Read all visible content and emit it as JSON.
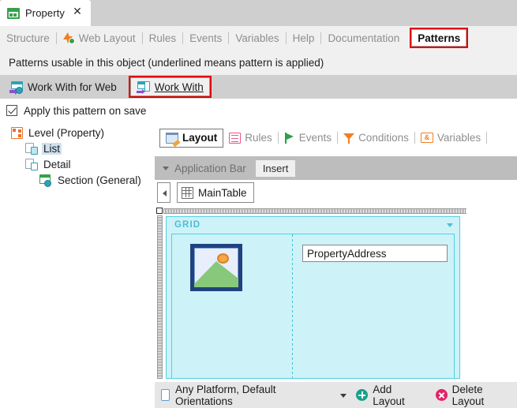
{
  "window": {
    "document_tab": {
      "title": "Property",
      "icon": "table-green-icon",
      "close_label": "✕"
    }
  },
  "object_tabs": [
    {
      "label": "Structure",
      "icon": null,
      "active": false
    },
    {
      "label": "Web Layout",
      "icon": "web-layout-icon",
      "active": false
    },
    {
      "label": "Rules",
      "icon": null,
      "active": false
    },
    {
      "label": "Events",
      "icon": null,
      "active": false
    },
    {
      "label": "Variables",
      "icon": null,
      "active": false
    },
    {
      "label": "Help",
      "icon": null,
      "active": false
    },
    {
      "label": "Documentation",
      "icon": null,
      "active": false
    },
    {
      "label": "Patterns",
      "icon": null,
      "active": true
    }
  ],
  "patterns": {
    "description": "Patterns usable in this object (underlined means pattern is applied)",
    "items": [
      {
        "label": "Work With for Web",
        "icon": "work-with-for-web-icon",
        "selected": false
      },
      {
        "label": "Work With",
        "icon": "work-with-icon",
        "selected": true
      }
    ],
    "apply_on_save": {
      "label": "Apply this pattern on save",
      "checked": true
    }
  },
  "tree": [
    {
      "label": "Level (Property)",
      "icon": "level-icon",
      "indent": 0,
      "selected": false
    },
    {
      "label": "List",
      "icon": "node-list-icon",
      "indent": 1,
      "selected": true
    },
    {
      "label": "Detail",
      "icon": "node-detail-icon",
      "indent": 1,
      "selected": false
    },
    {
      "label": "Section (General)",
      "icon": "section-icon",
      "indent": 2,
      "selected": false
    }
  ],
  "editor": {
    "tabs": [
      {
        "label": "Layout",
        "icon": "layout-icon",
        "active": true
      },
      {
        "label": "Rules",
        "icon": "rules-icon",
        "active": false
      },
      {
        "label": "Events",
        "icon": "events-flag-icon",
        "active": false
      },
      {
        "label": "Conditions",
        "icon": "conditions-funnel-icon",
        "active": false
      },
      {
        "label": "Variables",
        "icon": "variables-icon",
        "active": false
      }
    ],
    "application_bar": {
      "title": "Application Bar",
      "insert_label": "Insert"
    },
    "main_table": {
      "label": "MainTable",
      "icon": "table-icon"
    },
    "grid": {
      "title": "GRID",
      "image_placeholder": "image-placeholder-icon",
      "field_value": "PropertyAddress"
    },
    "footer": {
      "platform_label": "Any Platform, Default Orientations",
      "platform_icon": "phone-icon",
      "add_layout_label": "Add Layout",
      "delete_layout_label": "Delete Layout"
    }
  },
  "colors": {
    "accent_red": "#e00000",
    "grid_fill": "#cdf2f8",
    "grid_border": "#54cfe0",
    "teal": "#2aa3b8"
  }
}
